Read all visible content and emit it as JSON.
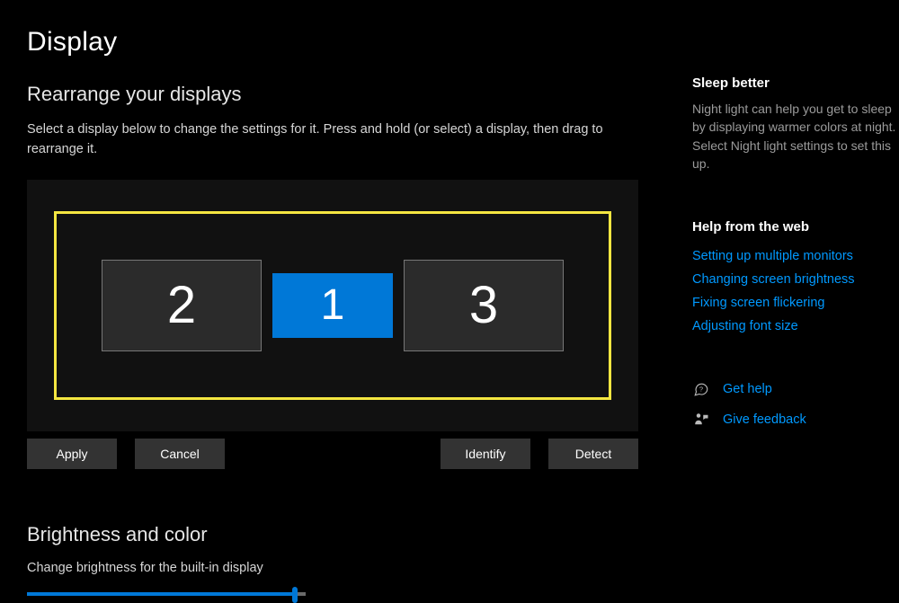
{
  "page": {
    "title": "Display"
  },
  "rearrange": {
    "heading": "Rearrange your displays",
    "description": "Select a display below to change the settings for it. Press and hold (or select) a display, then drag to rearrange it.",
    "monitors": {
      "left": {
        "label": "2",
        "selected": false
      },
      "center": {
        "label": "1",
        "selected": true
      },
      "right": {
        "label": "3",
        "selected": false
      }
    },
    "buttons": {
      "apply": "Apply",
      "cancel": "Cancel",
      "identify": "Identify",
      "detect": "Detect"
    }
  },
  "brightness": {
    "heading": "Brightness and color",
    "slider_label": "Change brightness for the built-in display"
  },
  "tips": {
    "heading": "Sleep better",
    "body": "Night light can help you get to sleep by displaying warmer colors at night. Select Night light settings to set this up."
  },
  "help": {
    "heading": "Help from the web",
    "links": {
      "a": "Setting up multiple monitors",
      "b": "Changing screen brightness",
      "c": "Fixing screen flickering",
      "d": "Adjusting font size"
    }
  },
  "feedback": {
    "get_help": "Get help",
    "give_feedback": "Give feedback"
  }
}
